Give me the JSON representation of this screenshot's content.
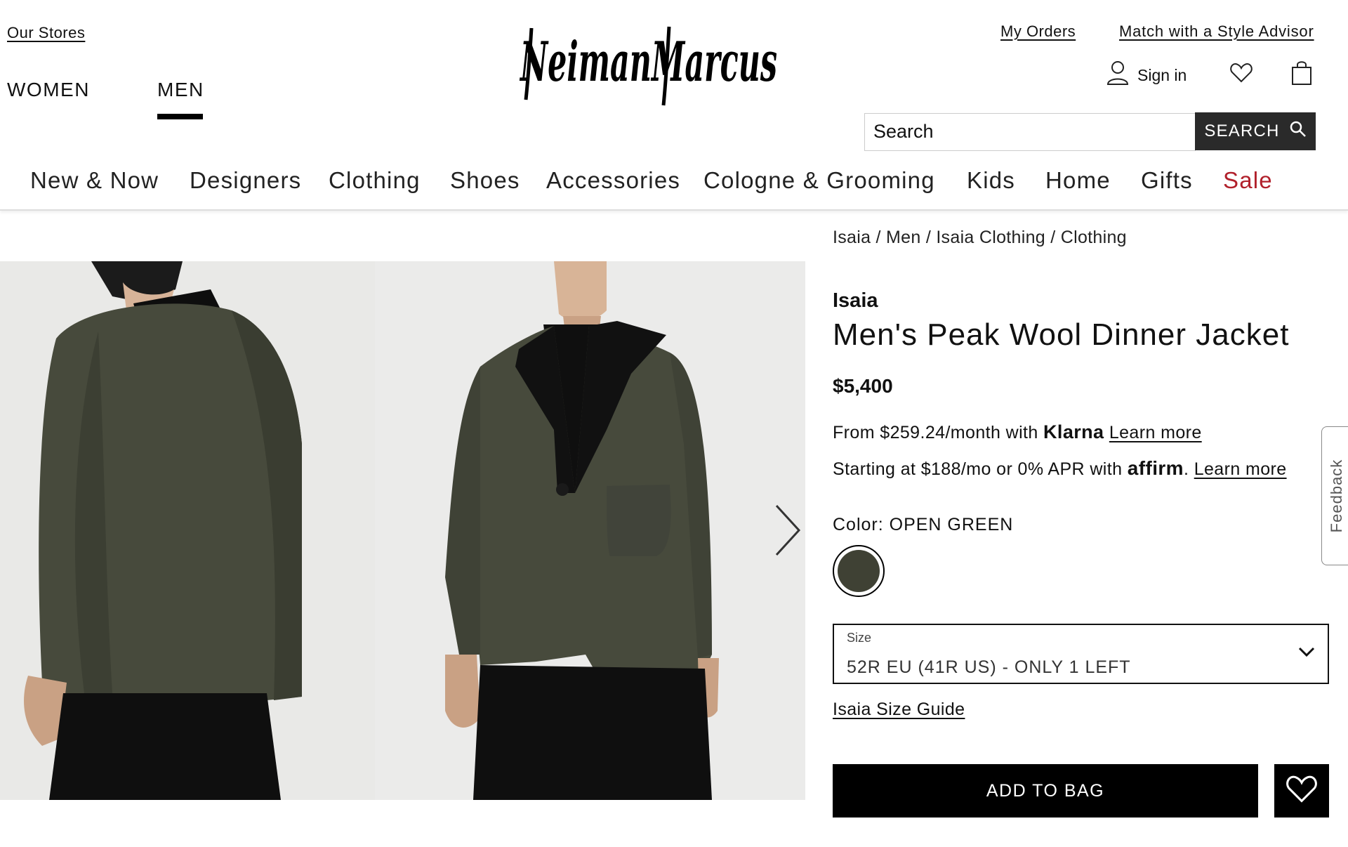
{
  "header": {
    "our_stores": "Our Stores",
    "genders": [
      "WOMEN",
      "MEN"
    ],
    "logo_text": "Neiman Marcus",
    "my_orders": "My Orders",
    "style_advisor": "Match with a Style Advisor",
    "sign_in": "Sign in",
    "search_placeholder": "Search",
    "search_button": "SEARCH"
  },
  "nav": {
    "items": [
      "New & Now",
      "Designers",
      "Clothing",
      "Shoes",
      "Accessories",
      "Cologne & Grooming",
      "Kids",
      "Home",
      "Gifts",
      "Sale"
    ]
  },
  "breadcrumb": "Isaia / Men / Isaia Clothing / Clothing",
  "product": {
    "brand": "Isaia",
    "name": "Men's Peak Wool Dinner Jacket",
    "price": "$5,400",
    "klarna": {
      "prefix": "From $259.24/month with",
      "logo": "Klarna",
      "link": "Learn more"
    },
    "affirm": {
      "prefix": "Starting at $188/mo or 0% APR with",
      "logo": "affirm",
      "link": "Learn more"
    },
    "color_label": "Color: OPEN GREEN",
    "swatch_color": "#3f4134",
    "size": {
      "caption": "Size",
      "value": "52R EU (41R US) - ONLY 1 LEFT"
    },
    "size_guide": "Isaia Size Guide",
    "add_to_bag": "ADD TO BAG"
  },
  "feedback": "Feedback",
  "colors": {
    "sale": "#b1202b",
    "jacket": "#474a3c",
    "lapel": "#111111"
  }
}
